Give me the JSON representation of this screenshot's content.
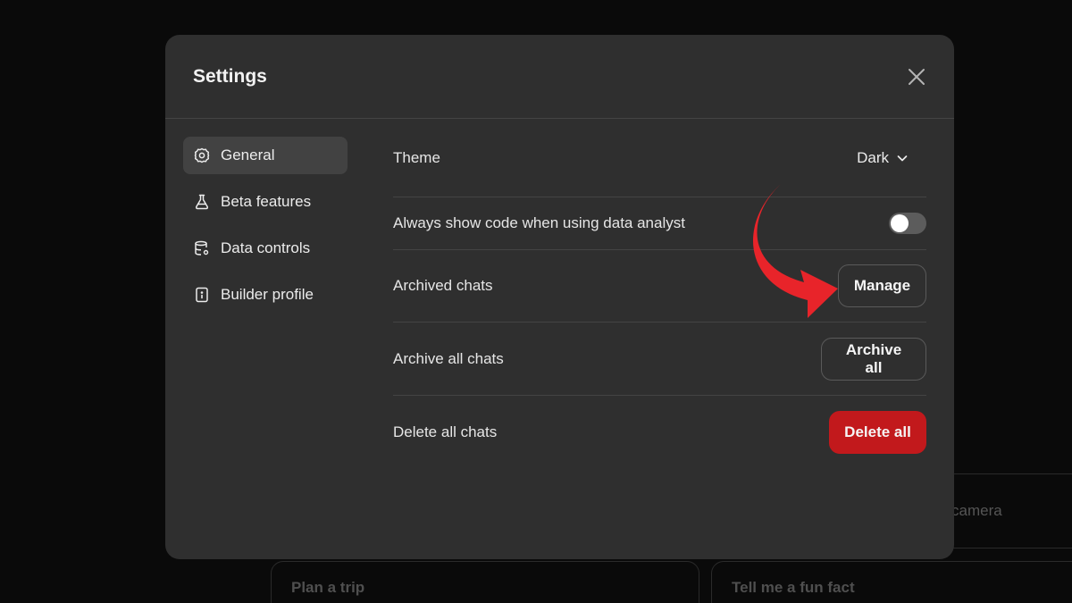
{
  "background": {
    "cards": [
      "Plan a trip",
      "Tell me a fun fact",
      "camera"
    ]
  },
  "modal": {
    "title": "Settings",
    "close_icon": "close-icon"
  },
  "sidebar": {
    "items": [
      {
        "label": "General",
        "icon": "gear-icon",
        "active": true
      },
      {
        "label": "Beta features",
        "icon": "flask-icon",
        "active": false
      },
      {
        "label": "Data controls",
        "icon": "database-icon",
        "active": false
      },
      {
        "label": "Builder profile",
        "icon": "id-card-icon",
        "active": false
      }
    ]
  },
  "settings": {
    "theme": {
      "label": "Theme",
      "value": "Dark"
    },
    "code": {
      "label": "Always show code when using data analyst",
      "enabled": false
    },
    "archived": {
      "label": "Archived chats",
      "button": "Manage"
    },
    "archive_all": {
      "label": "Archive all chats",
      "button": "Archive all"
    },
    "delete_all": {
      "label": "Delete all chats",
      "button": "Delete all"
    }
  },
  "colors": {
    "accent_danger": "#c2191c",
    "annotation_arrow": "#e8242a",
    "modal_bg": "#2f2f2f",
    "page_bg": "#0a0a0a"
  }
}
